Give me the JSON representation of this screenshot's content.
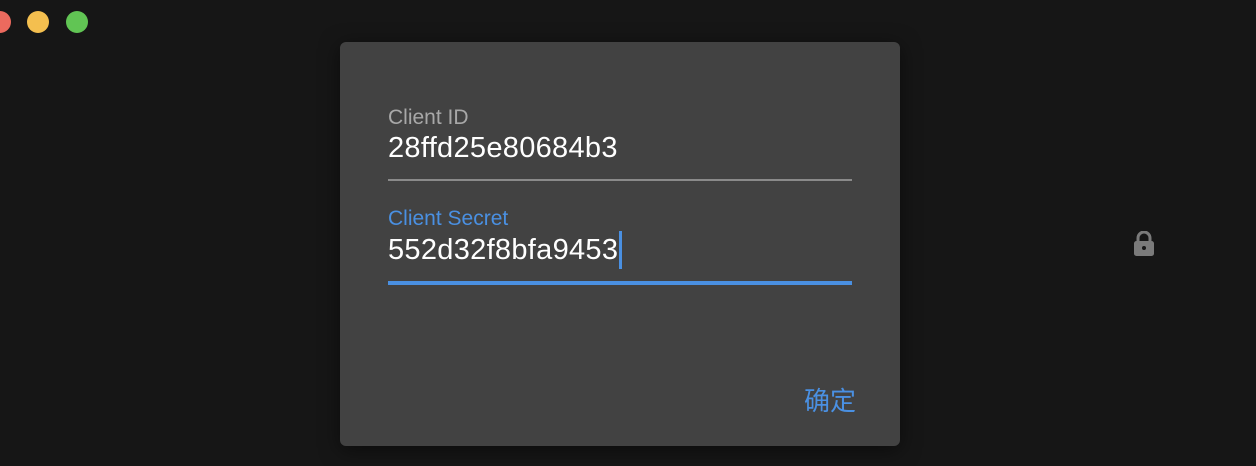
{
  "window": {
    "controls": [
      "close",
      "minimize",
      "zoom"
    ]
  },
  "dialog": {
    "client_id": {
      "label": "Client ID",
      "value": "28ffd25e80684b3"
    },
    "client_secret": {
      "label": "Client Secret",
      "value": "552d32f8bfa9453"
    },
    "confirm_label": "确定"
  },
  "colors": {
    "accent": "#4a90e2",
    "dialog_bg": "#424242",
    "background": "#161616"
  },
  "icons": {
    "lock": "lock-icon"
  }
}
